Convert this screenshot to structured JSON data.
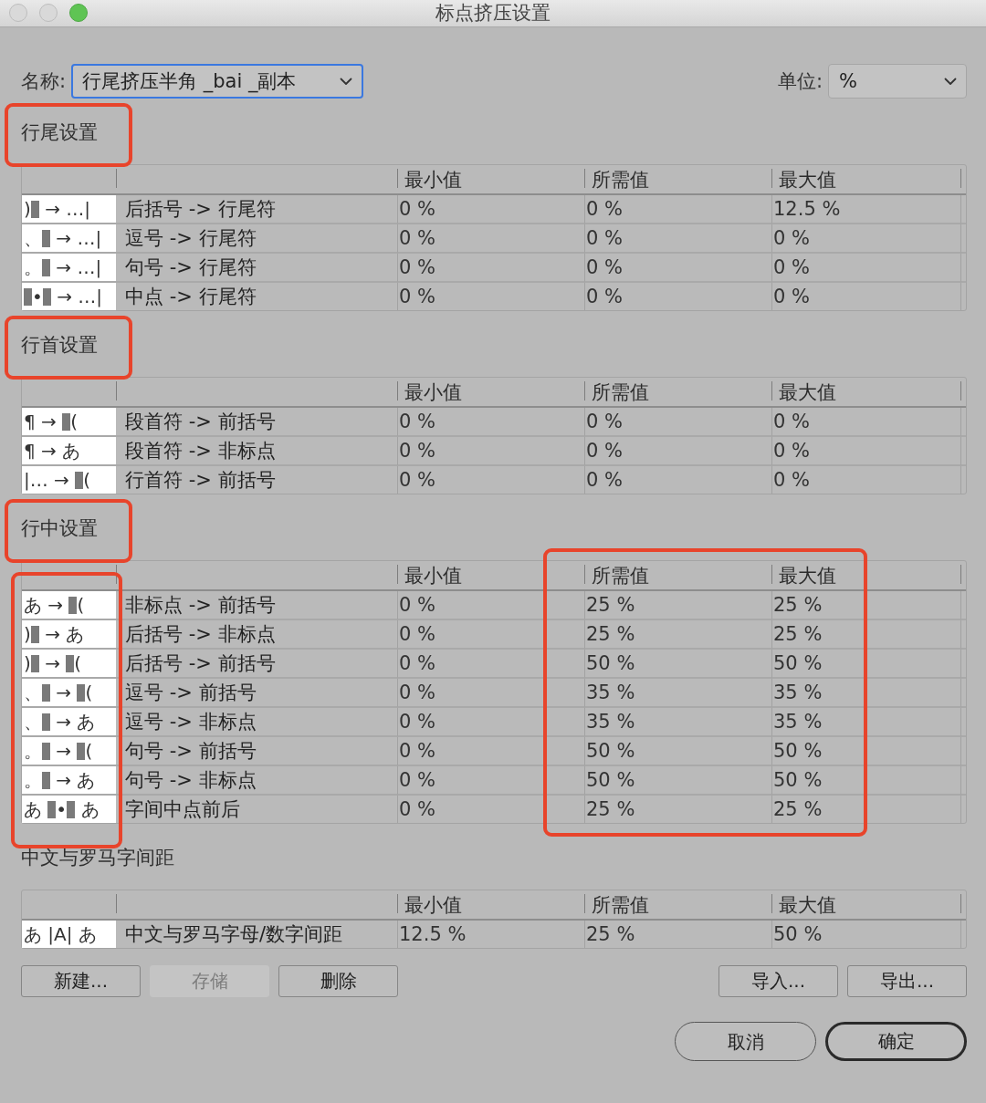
{
  "window": {
    "title": "标点挤压设置",
    "traffic_lights": [
      {
        "kind": "close",
        "enabled": false
      },
      {
        "kind": "minimize",
        "enabled": false
      },
      {
        "kind": "zoom",
        "enabled": true
      }
    ]
  },
  "name_field": {
    "label": "名称:",
    "value": "行尾挤压半角 _bai _副本",
    "focused": true
  },
  "unit_field": {
    "label": "单位:",
    "value": "%",
    "focused": false
  },
  "sections": [
    {
      "title": "行尾设置",
      "title_marked": true,
      "symbol_column_marked": false,
      "columns": [
        {
          "label": "最小值",
          "marked": false
        },
        {
          "label": "所需值",
          "marked": false
        },
        {
          "label": "最大值",
          "marked": false
        }
      ],
      "rows": [
        {
          "symbol": [
            {
              "kind": "text",
              "text": ")"
            },
            {
              "kind": "block"
            },
            {
              "kind": "text",
              "text": " → …|"
            }
          ],
          "label": "后括号 -> 行尾符",
          "values": [
            "0 %",
            "0 %",
            "12.5 %"
          ]
        },
        {
          "symbol": [
            {
              "kind": "text",
              "text": "、"
            },
            {
              "kind": "block"
            },
            {
              "kind": "text",
              "text": " → …|"
            }
          ],
          "label": "逗号 -> 行尾符",
          "values": [
            "0 %",
            "0 %",
            "0 %"
          ]
        },
        {
          "symbol": [
            {
              "kind": "text",
              "text": "。"
            },
            {
              "kind": "block"
            },
            {
              "kind": "text",
              "text": " → …|"
            }
          ],
          "label": "句号 -> 行尾符",
          "values": [
            "0 %",
            "0 %",
            "0 %"
          ]
        },
        {
          "symbol": [
            {
              "kind": "block"
            },
            {
              "kind": "text",
              "text": "•"
            },
            {
              "kind": "block"
            },
            {
              "kind": "text",
              "text": " → …|"
            }
          ],
          "label": "中点 -> 行尾符",
          "values": [
            "0 %",
            "0 %",
            "0 %"
          ]
        }
      ]
    },
    {
      "title": "行首设置",
      "title_marked": true,
      "symbol_column_marked": false,
      "columns": [
        {
          "label": "最小值",
          "marked": false
        },
        {
          "label": "所需值",
          "marked": false
        },
        {
          "label": "最大值",
          "marked": false
        }
      ],
      "rows": [
        {
          "symbol": [
            {
              "kind": "text",
              "text": "¶ → "
            },
            {
              "kind": "block"
            },
            {
              "kind": "text",
              "text": "("
            }
          ],
          "label": "段首符 -> 前括号",
          "values": [
            "0 %",
            "0 %",
            "0 %"
          ]
        },
        {
          "symbol": [
            {
              "kind": "text",
              "text": "¶ → あ"
            }
          ],
          "label": "段首符 -> 非标点",
          "values": [
            "0 %",
            "0 %",
            "0 %"
          ]
        },
        {
          "symbol": [
            {
              "kind": "text",
              "text": "|… → "
            },
            {
              "kind": "block"
            },
            {
              "kind": "text",
              "text": "("
            }
          ],
          "label": "行首符 -> 前括号",
          "values": [
            "0 %",
            "0 %",
            "0 %"
          ]
        }
      ]
    },
    {
      "title": "行中设置",
      "title_marked": true,
      "symbol_column_marked": true,
      "columns": [
        {
          "label": "最小值",
          "marked": false
        },
        {
          "label": "所需值",
          "marked": true
        },
        {
          "label": "最大值",
          "marked": true
        }
      ],
      "rows": [
        {
          "symbol": [
            {
              "kind": "text",
              "text": "あ → "
            },
            {
              "kind": "block"
            },
            {
              "kind": "text",
              "text": "("
            }
          ],
          "label": "非标点 -> 前括号",
          "values": [
            "0 %",
            "25 %",
            "25 %"
          ]
        },
        {
          "symbol": [
            {
              "kind": "text",
              "text": ")"
            },
            {
              "kind": "block"
            },
            {
              "kind": "text",
              "text": " → あ"
            }
          ],
          "label": "后括号 -> 非标点",
          "values": [
            "0 %",
            "25 %",
            "25 %"
          ]
        },
        {
          "symbol": [
            {
              "kind": "text",
              "text": ")"
            },
            {
              "kind": "block"
            },
            {
              "kind": "text",
              "text": " → "
            },
            {
              "kind": "block"
            },
            {
              "kind": "text",
              "text": "("
            }
          ],
          "label": "后括号 -> 前括号",
          "values": [
            "0 %",
            "50 %",
            "50 %"
          ]
        },
        {
          "symbol": [
            {
              "kind": "text",
              "text": "、"
            },
            {
              "kind": "block"
            },
            {
              "kind": "text",
              "text": " → "
            },
            {
              "kind": "block"
            },
            {
              "kind": "text",
              "text": "("
            }
          ],
          "label": "逗号 -> 前括号",
          "values": [
            "0 %",
            "35 %",
            "35 %"
          ]
        },
        {
          "symbol": [
            {
              "kind": "text",
              "text": "、"
            },
            {
              "kind": "block"
            },
            {
              "kind": "text",
              "text": " → あ"
            }
          ],
          "label": "逗号 -> 非标点",
          "values": [
            "0 %",
            "35 %",
            "35 %"
          ]
        },
        {
          "symbol": [
            {
              "kind": "text",
              "text": "。"
            },
            {
              "kind": "block"
            },
            {
              "kind": "text",
              "text": " → "
            },
            {
              "kind": "block"
            },
            {
              "kind": "text",
              "text": "("
            }
          ],
          "label": "句号 -> 前括号",
          "values": [
            "0 %",
            "50 %",
            "50 %"
          ]
        },
        {
          "symbol": [
            {
              "kind": "text",
              "text": "。"
            },
            {
              "kind": "block"
            },
            {
              "kind": "text",
              "text": " → あ"
            }
          ],
          "label": "句号 -> 非标点",
          "values": [
            "0 %",
            "50 %",
            "50 %"
          ]
        },
        {
          "symbol": [
            {
              "kind": "text",
              "text": "あ "
            },
            {
              "kind": "block"
            },
            {
              "kind": "text",
              "text": "•"
            },
            {
              "kind": "block"
            },
            {
              "kind": "text",
              "text": " あ"
            }
          ],
          "label": "字间中点前后",
          "values": [
            "0 %",
            "25 %",
            "25 %"
          ]
        }
      ]
    },
    {
      "title": "中文与罗马字间距",
      "title_marked": false,
      "symbol_column_marked": false,
      "columns": [
        {
          "label": "最小值",
          "marked": false
        },
        {
          "label": "所需值",
          "marked": false
        },
        {
          "label": "最大值",
          "marked": false
        }
      ],
      "rows": [
        {
          "symbol": [
            {
              "kind": "text",
              "text": "あ |A| あ"
            }
          ],
          "label": "中文与罗马字母/数字间距",
          "values": [
            "12.5 %",
            "25 %",
            "50 %"
          ]
        }
      ]
    }
  ],
  "buttons_left": [
    {
      "label": "新建...",
      "disabled": false
    },
    {
      "label": "存储",
      "disabled": true
    },
    {
      "label": "删除",
      "disabled": false
    }
  ],
  "buttons_right": [
    {
      "label": "导入...",
      "disabled": false
    },
    {
      "label": "导出...",
      "disabled": false
    }
  ],
  "dialog_buttons": [
    {
      "label": "取消",
      "default": false
    },
    {
      "label": "确定",
      "default": true
    }
  ]
}
